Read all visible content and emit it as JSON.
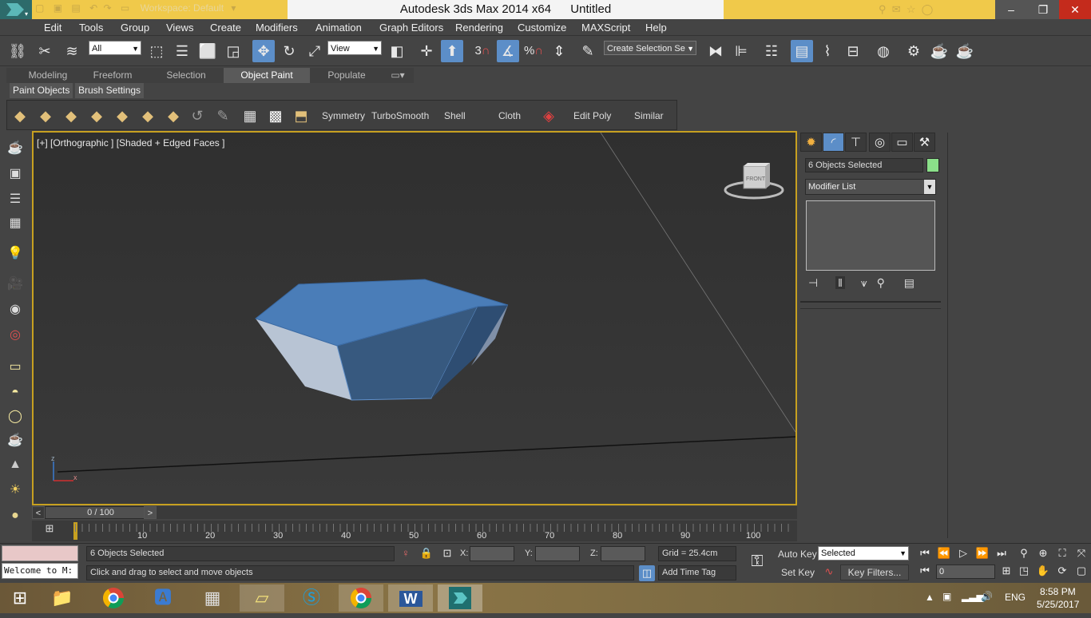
{
  "titlebar": {
    "workspace": "Workspace: Default",
    "app": "Autodesk 3ds Max  2014 x64",
    "doc": "Untitled"
  },
  "menu": [
    "Edit",
    "Tools",
    "Group",
    "Views",
    "Create",
    "Modifiers",
    "Animation",
    "Graph Editors",
    "Rendering",
    "Customize",
    "MAXScript",
    "Help"
  ],
  "toolbar": {
    "filter": "All",
    "refcoord": "View",
    "snap_number": "3",
    "selection_set": "Create Selection Se"
  },
  "ribbon": {
    "tabs": [
      "Modeling",
      "Freeform",
      "Selection",
      "Object Paint",
      "Populate"
    ],
    "active_tab": "Object Paint",
    "subtabs": [
      "Paint Objects",
      "Brush Settings"
    ]
  },
  "brush_labels": [
    "Symmetry",
    "TurboSmooth",
    "Shell",
    "Cloth",
    "Edit Poly",
    "Similar"
  ],
  "viewport": {
    "label": "[+] [Orthographic ] [Shaded + Edged Faces ]",
    "viewcube_face": "FRONT",
    "axis_z": "z",
    "axis_x": "x"
  },
  "timeline": {
    "frame": "0 / 100",
    "prev": "<",
    "next": ">",
    "ruler_labels": [
      "10",
      "20",
      "30",
      "40",
      "50",
      "60",
      "70",
      "80",
      "90",
      "100"
    ]
  },
  "status": {
    "maxscript": "Welcome to M:",
    "selection": "6 Objects Selected",
    "prompt": "Click and drag to select and move objects",
    "x_label": "X:",
    "y_label": "Y:",
    "z_label": "Z:",
    "grid": "Grid = 25.4cm",
    "add_time_tag": "Add Time Tag",
    "auto_key": "Auto Key",
    "set_key": "Set Key",
    "key_mode": "Selected",
    "key_filters": "Key Filters...",
    "frame_value": "0"
  },
  "cmdpanel": {
    "objects_selected": "6 Objects Selected",
    "modifier_list": "Modifier List",
    "swatch_color": "#8be08a"
  },
  "tray": {
    "lang": "ENG",
    "time": "8:58 PM",
    "date": "5/25/2017"
  },
  "colors": {
    "object": "#4a7db8",
    "viewport_border": "#c7a020",
    "highlight": "#5c8ec8"
  }
}
